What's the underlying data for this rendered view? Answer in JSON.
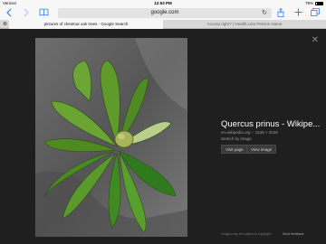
{
  "status_bar": {
    "carrier": "Verizon",
    "time": "12:53 PM",
    "battery": "79%"
  },
  "toolbar": {
    "url": "google.com",
    "back_icon": "chevron-left-icon",
    "forward_icon": "chevron-right-icon",
    "bookmarks_icon": "book-icon",
    "reload_icon": "reload-icon",
    "share_icon": "share-icon",
    "new_tab_icon": "plus-icon",
    "tabs_icon": "tabs-icon",
    "accent": "#2f7df6"
  },
  "tabs": [
    {
      "label": "pictures of chestnut oak trees - Google Search",
      "active": true
    },
    {
      "label": "Access right? | Health.com Pelvine Name",
      "active": false
    }
  ],
  "viewer": {
    "title": "Quercus prinus - Wikipe...",
    "source": "en.wikipedia.org",
    "dimensions": "1536 × 2048",
    "search_by_image": "Search by image",
    "visit_button": "Visit page",
    "view_button": "View image",
    "footer_note": "Images may be subject to copyright.",
    "footer_link": "Send feedback",
    "close_icon": "close-icon"
  }
}
